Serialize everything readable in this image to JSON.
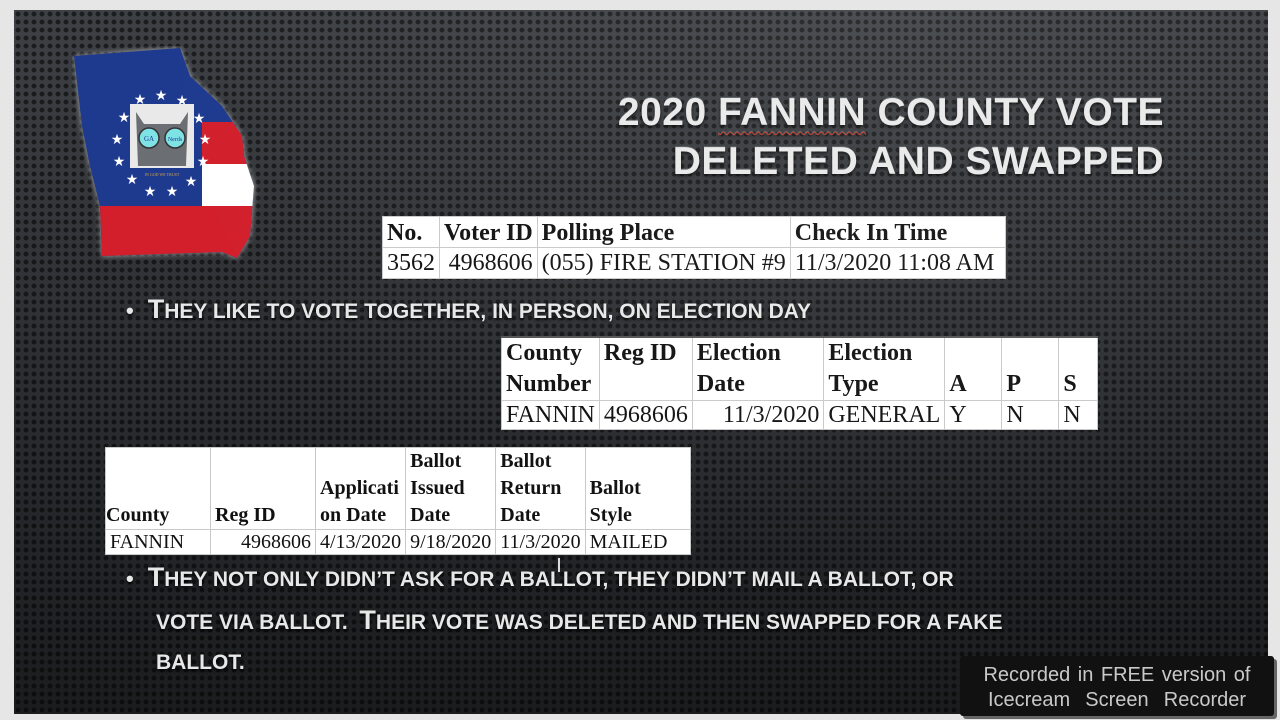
{
  "title": {
    "line1_prefix": "2020 ",
    "line1_word": "FANNIN",
    "line1_suffix": " COUNTY VOTE",
    "line2": "DELETED AND SWAPPED"
  },
  "logo": {
    "left_lens": "GA",
    "right_lens": "Nerds",
    "motto": "IN GOD WE TRUST"
  },
  "bullets": [
    {
      "first_letter": "T",
      "text": "HEY LIKE TO VOTE TOGETHER, IN PERSON, ON ELECTION DAY"
    },
    {
      "line1_first": "T",
      "line1": "HEY NOT ONLY DIDN’T ASK FOR A BALLOT, THEY DIDN’T MAIL A BALLOT, OR",
      "line2a": "VOTE VIA BALLOT.  ",
      "line2_first": "T",
      "line2b": "HEIR VOTE WAS DELETED AND THEN SWAPPED FOR A FAKE",
      "line3": "BALLOT."
    }
  ],
  "checkin_table": {
    "headers": [
      "No.",
      "Voter ID",
      "Polling Place",
      "Check In Time"
    ],
    "row": [
      "3562",
      "4968606",
      "(055) FIRE STATION #9",
      "11/3/2020 11:08 AM"
    ]
  },
  "election_table": {
    "headers": [
      [
        "County",
        "Number"
      ],
      [
        "Reg ID",
        ""
      ],
      [
        "Election",
        "Date"
      ],
      [
        "Election",
        "Type"
      ],
      [
        "",
        "A"
      ],
      [
        "",
        "P"
      ],
      [
        "",
        "S"
      ]
    ],
    "row": [
      "FANNIN",
      "4968606",
      "11/3/2020",
      "GENERAL",
      "Y",
      "N",
      "N"
    ]
  },
  "absentee_table": {
    "headers": [
      [
        "",
        "",
        "County"
      ],
      [
        "",
        "",
        "Reg ID"
      ],
      [
        "",
        "Applicati",
        "on Date"
      ],
      [
        "Ballot",
        "Issued",
        "Date"
      ],
      [
        "Ballot",
        "Return",
        "Date"
      ],
      [
        "",
        "Ballot",
        "Style"
      ]
    ],
    "row": [
      "FANNIN",
      "4968606",
      "4/13/2020",
      "9/18/2020",
      "11/3/2020",
      "MAILED"
    ]
  },
  "watermark": {
    "line1": "Recorded in FREE version of",
    "line2": "Icecream  Screen  Recorder"
  },
  "colors": {
    "flag_blue": "#1d3a8f",
    "flag_red": "#d21f2b",
    "lens": "#7fe3e6",
    "title_text": "#e9e9ea"
  }
}
